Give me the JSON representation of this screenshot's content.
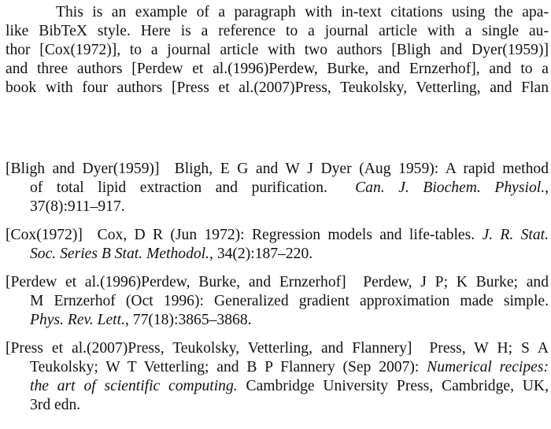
{
  "paragraph": {
    "lines": [
      "This is an example of a paragraph with in-text citations using the apa-",
      "like BibTeX style.  Here is a reference to a journal article with a single au-",
      "thor [Cox(1972)], to a journal article with two authors [Bligh and Dyer(1959)]",
      "and three authors [Perdew et al.(1996)Perdew, Burke, and Ernzerhof], and to a",
      "book with four authors [Press et al.(2007)Press, Teukolsky, Vetterling, and Flan"
    ]
  },
  "bibliography": {
    "entries": [
      {
        "label": "[Bligh and Dyer(1959)]",
        "line1_rest": "Bligh, E G and W J Dyer (Aug 1959): A rapid method",
        "line2_text": "of total lipid extraction and purification.",
        "line2_journal": "Can. J. Biochem. Physiol.",
        "line2_tail": ",",
        "line3": "37(8):911–917."
      },
      {
        "label": "[Cox(1972)]",
        "line1_rest": "Cox, D R (Jun 1972): Regression models and life-tables.",
        "line1_journal": "J. R. Stat.",
        "line2_journal": "Soc. Series B Stat. Methodol.",
        "line2_tail": ", 34(2):187–220."
      },
      {
        "label": "[Perdew et al.(1996)Perdew, Burke, and Ernzerhof]",
        "line1_rest": "Perdew, J P; K Burke; and",
        "line2": "M Ernzerhof (Oct 1996): Generalized gradient approximation made simple.",
        "line3_journal": "Phys. Rev. Lett.",
        "line3_tail": ", 77(18):3865–3868."
      },
      {
        "label": "[Press et al.(2007)Press, Teukolsky, Vetterling, and Flannery]",
        "line1_rest": "Press, W H; S A",
        "line2_text": "Teukolsky; W T Vetterling; and B P Flannery (Sep 2007):",
        "line2_title": "Numerical recipes:",
        "line3_title": "the art of scientific computing.",
        "line3_tail": "Cambridge University Press, Cambridge, UK,",
        "line4": "3rd edn."
      }
    ]
  }
}
